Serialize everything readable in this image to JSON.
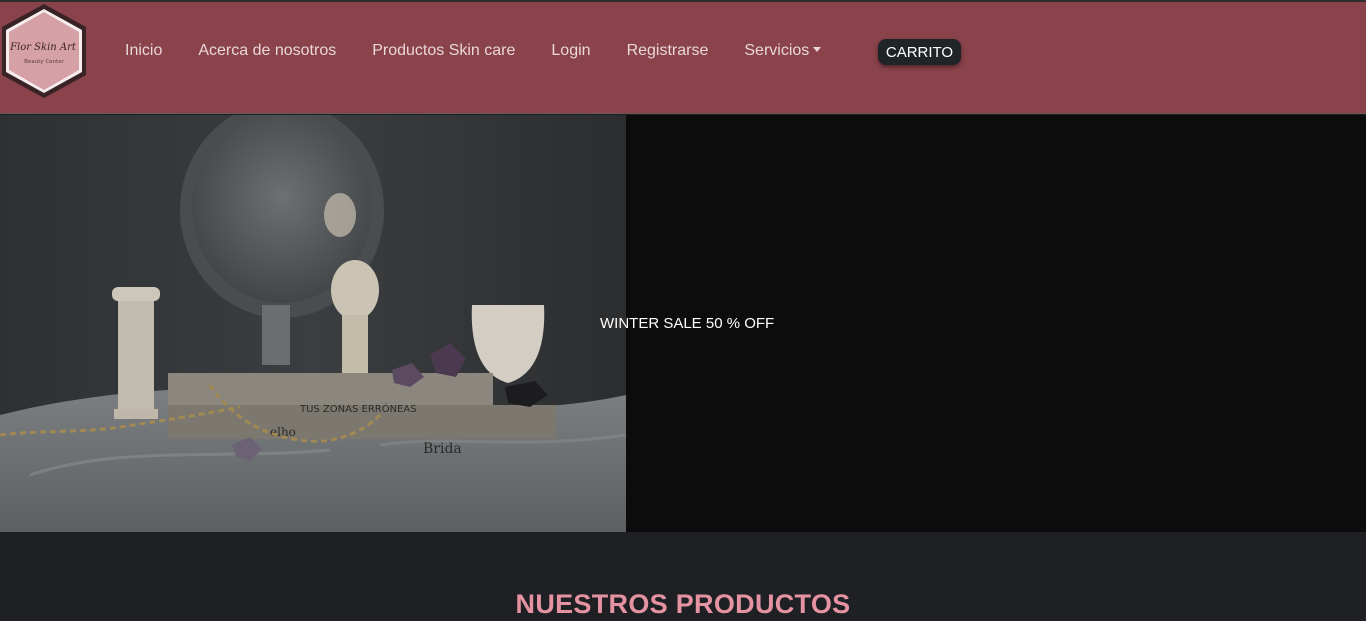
{
  "brand": {
    "logo_text": "Flor Skin Art",
    "logo_subtitle": "Beauty Center"
  },
  "nav": {
    "items": [
      {
        "label": "Inicio"
      },
      {
        "label": "Acerca de nosotros"
      },
      {
        "label": "Productos Skin care"
      },
      {
        "label": "Login"
      },
      {
        "label": "Registrarse"
      },
      {
        "label": "Servicios"
      }
    ],
    "cart_label": "CARRITO"
  },
  "hero": {
    "caption": "WINTER SALE 50 % OFF",
    "photo_text": {
      "book_top": "TUS ZONAS ERRÓNEAS",
      "book_bottom": "Brida",
      "book_partial": "elho"
    }
  },
  "products": {
    "title": "NUESTROS PRODUCTOS"
  },
  "colors": {
    "navbar": "#8a434b",
    "nav_text": "#e9d7d9",
    "cart_button": "#212427",
    "hero_bg": "#0c0c0d",
    "page_bg": "#1f2023",
    "products_title": "#e593a3"
  },
  "icons": {
    "logo": "hexagon-logo",
    "servicios_caret": "caret-down-icon"
  }
}
